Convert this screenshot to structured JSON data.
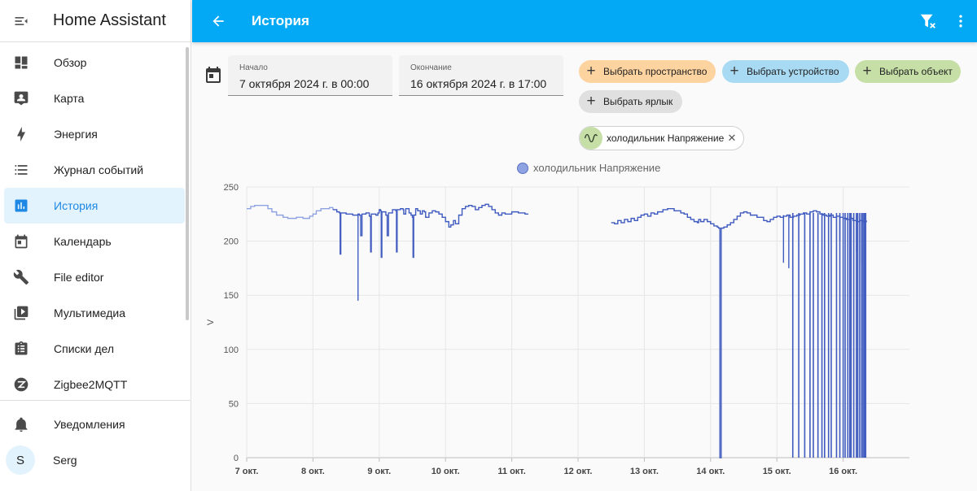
{
  "sidebar": {
    "title": "Home Assistant",
    "items": [
      {
        "label": "Обзор",
        "icon": "dashboard-icon"
      },
      {
        "label": "Карта",
        "icon": "map-icon"
      },
      {
        "label": "Энергия",
        "icon": "lightning-bolt-icon"
      },
      {
        "label": "Журнал событий",
        "icon": "list-icon"
      },
      {
        "label": "История",
        "icon": "chart-box-icon",
        "active": true
      },
      {
        "label": "Календарь",
        "icon": "calendar-icon"
      },
      {
        "label": "File editor",
        "icon": "wrench-icon"
      },
      {
        "label": "Мультимедиа",
        "icon": "play-box-icon"
      },
      {
        "label": "Списки дел",
        "icon": "clipboard-list-icon"
      },
      {
        "label": "Zigbee2MQTT",
        "icon": "zigbee-icon"
      }
    ],
    "notifications": "Уведомления",
    "user": {
      "initial": "S",
      "name": "Serg"
    }
  },
  "topbar": {
    "title": "История"
  },
  "filters": {
    "start_label": "Начало",
    "start_value": "7 октября 2024 г. в 00:00",
    "end_label": "Окончание",
    "end_value": "16 октября 2024 г. в 17:00",
    "chip_area": "Выбрать пространство",
    "chip_device": "Выбрать устройство",
    "chip_entity": "Выбрать объект",
    "chip_label": "Выбрать ярлык",
    "selected_entity": "холодильник Напряжение"
  },
  "colors": {
    "accent": "#03a9f4",
    "active_nav": "#1e88e5",
    "series": "#3f5bbf",
    "series_light": "#8fa3e3"
  },
  "chart_data": {
    "type": "line",
    "series_name": "холодильник Напряжение",
    "ylabel": "V",
    "ylim": [
      0,
      250
    ],
    "yticks": [
      0,
      50,
      100,
      150,
      200,
      250
    ],
    "xlabels": [
      "7 окт.",
      "8 окт.",
      "9 окт.",
      "10 окт.",
      "11 окт.",
      "12 окт.",
      "13 окт.",
      "14 окт.",
      "15 окт.",
      "16 окт."
    ],
    "x_unit": "days since 7 окт. 00:00",
    "xlim": [
      0,
      10
    ],
    "grid": true,
    "legend_position": "top-center",
    "series": [
      {
        "name": "холодильник Напряжение (early, light)",
        "points": [
          [
            0.0,
            230
          ],
          [
            0.06,
            232
          ],
          [
            0.12,
            233
          ],
          [
            0.25,
            233
          ],
          [
            0.32,
            230
          ],
          [
            0.38,
            227
          ],
          [
            0.45,
            224
          ],
          [
            0.55,
            222
          ],
          [
            0.62,
            221
          ],
          [
            0.75,
            222
          ],
          [
            0.85,
            221
          ],
          [
            0.95,
            223
          ],
          [
            1.0,
            225
          ],
          [
            1.05,
            228
          ],
          [
            1.12,
            230
          ],
          [
            1.18,
            230
          ],
          [
            1.25,
            231
          ],
          [
            1.3,
            229
          ]
        ]
      },
      {
        "name": "холодильник Напряжение (period 1)",
        "points": [
          [
            1.3,
            229
          ],
          [
            1.36,
            227
          ],
          [
            1.4,
            226
          ],
          [
            1.41,
            188
          ],
          [
            1.42,
            226
          ],
          [
            1.5,
            225
          ],
          [
            1.6,
            224
          ],
          [
            1.68,
            225
          ],
          [
            1.7,
            224
          ],
          [
            1.72,
            205
          ],
          [
            1.74,
            225
          ],
          [
            1.8,
            226
          ],
          [
            1.85,
            223
          ],
          [
            1.87,
            190
          ],
          [
            1.88,
            225
          ],
          [
            1.95,
            224
          ],
          [
            1.98,
            226
          ],
          [
            2.0,
            229
          ],
          [
            2.02,
            228
          ],
          [
            2.03,
            185
          ],
          [
            2.04,
            227
          ],
          [
            2.1,
            224
          ],
          [
            2.12,
            205
          ],
          [
            2.14,
            226
          ],
          [
            2.2,
            229
          ],
          [
            2.25,
            228
          ],
          [
            2.26,
            190
          ],
          [
            2.27,
            229
          ],
          [
            2.32,
            230
          ],
          [
            2.36,
            229
          ],
          [
            2.37,
            225
          ],
          [
            2.4,
            230
          ],
          [
            2.45,
            226
          ],
          [
            2.48,
            224
          ],
          [
            2.5,
            222
          ],
          [
            2.51,
            185
          ],
          [
            2.52,
            224
          ],
          [
            2.55,
            230
          ],
          [
            2.58,
            228
          ],
          [
            2.62,
            225
          ],
          [
            2.65,
            228
          ],
          [
            2.68,
            227
          ],
          [
            2.7,
            222
          ],
          [
            2.75,
            226
          ],
          [
            2.8,
            228
          ],
          [
            2.85,
            227
          ],
          [
            2.9,
            225
          ],
          [
            2.95,
            222
          ],
          [
            3.0,
            218
          ],
          [
            3.05,
            213
          ],
          [
            3.08,
            215
          ],
          [
            3.12,
            219
          ],
          [
            3.15,
            216
          ],
          [
            3.2,
            224
          ],
          [
            3.25,
            230
          ],
          [
            3.3,
            232
          ],
          [
            3.35,
            233
          ],
          [
            3.4,
            232
          ],
          [
            3.45,
            229
          ],
          [
            3.5,
            231
          ],
          [
            3.55,
            233
          ],
          [
            3.6,
            234
          ],
          [
            3.65,
            232
          ],
          [
            3.7,
            229
          ],
          [
            3.75,
            226
          ],
          [
            3.8,
            224
          ],
          [
            3.85,
            226
          ],
          [
            3.9,
            225
          ],
          [
            4.0,
            227
          ],
          [
            4.1,
            226
          ],
          [
            4.2,
            225
          ],
          [
            4.25,
            225
          ]
        ]
      },
      {
        "name": "холодильник Напряжение (period 2)",
        "points": [
          [
            5.5,
            217
          ],
          [
            5.55,
            216
          ],
          [
            5.6,
            219
          ],
          [
            5.65,
            217
          ],
          [
            5.7,
            220
          ],
          [
            5.75,
            218
          ],
          [
            5.8,
            221
          ],
          [
            5.85,
            219
          ],
          [
            5.9,
            222
          ],
          [
            5.95,
            224
          ],
          [
            6.0,
            225
          ],
          [
            6.05,
            223
          ],
          [
            6.1,
            226
          ],
          [
            6.15,
            225
          ],
          [
            6.2,
            227
          ],
          [
            6.28,
            229
          ],
          [
            6.35,
            230
          ],
          [
            6.45,
            228
          ],
          [
            6.55,
            226
          ],
          [
            6.6,
            225
          ],
          [
            6.65,
            222
          ],
          [
            6.7,
            220
          ],
          [
            6.75,
            218
          ],
          [
            6.8,
            217
          ],
          [
            6.82,
            220
          ],
          [
            6.85,
            218
          ],
          [
            6.9,
            220
          ],
          [
            6.95,
            218
          ],
          [
            7.0,
            216
          ],
          [
            7.05,
            214
          ],
          [
            7.1,
            213
          ],
          [
            7.12,
            212
          ],
          [
            7.14,
            0
          ],
          [
            7.16,
            212
          ],
          [
            7.2,
            213
          ],
          [
            7.25,
            215
          ],
          [
            7.3,
            217
          ],
          [
            7.35,
            220
          ],
          [
            7.4,
            223
          ],
          [
            7.45,
            226
          ],
          [
            7.5,
            227
          ],
          [
            7.55,
            226
          ],
          [
            7.6,
            224
          ],
          [
            7.7,
            222
          ],
          [
            7.8,
            219
          ],
          [
            7.85,
            218
          ],
          [
            7.9,
            220
          ],
          [
            7.95,
            222
          ],
          [
            8.0,
            223
          ],
          [
            8.05,
            222
          ],
          [
            8.1,
            223
          ],
          [
            8.15,
            224
          ],
          [
            8.2,
            222
          ],
          [
            8.25,
            223
          ],
          [
            8.3,
            224
          ],
          [
            8.35,
            225
          ],
          [
            8.4,
            226
          ],
          [
            8.45,
            225
          ],
          [
            8.5,
            227
          ],
          [
            8.55,
            228
          ],
          [
            8.6,
            227
          ],
          [
            8.65,
            225
          ],
          [
            8.7,
            224
          ],
          [
            8.75,
            223
          ],
          [
            8.8,
            224
          ],
          [
            8.85,
            222
          ],
          [
            8.9,
            223
          ],
          [
            8.95,
            222
          ],
          [
            9.0,
            221
          ],
          [
            9.05,
            220
          ],
          [
            9.1,
            221
          ],
          [
            9.15,
            219
          ],
          [
            9.2,
            218
          ],
          [
            9.25,
            219
          ],
          [
            9.3,
            218
          ],
          [
            9.35,
            219
          ]
        ]
      }
    ],
    "spikes": {
      "period1_deep": [
        [
          1.68,
          145
        ]
      ],
      "period2_zero_x": [
        8.24,
        8.33,
        8.42,
        8.5,
        8.55,
        8.62,
        8.68,
        8.72,
        8.78,
        8.82,
        8.9,
        8.95,
        9.0,
        9.03,
        9.07,
        9.1,
        9.12,
        9.16,
        9.2,
        9.22,
        9.25,
        9.28,
        9.3,
        9.32,
        9.34
      ],
      "period2_partial": [
        [
          8.1,
          180
        ],
        [
          8.18,
          175
        ],
        [
          8.95,
          200
        ],
        [
          9.2,
          190
        ],
        [
          9.28,
          180
        ]
      ]
    }
  }
}
